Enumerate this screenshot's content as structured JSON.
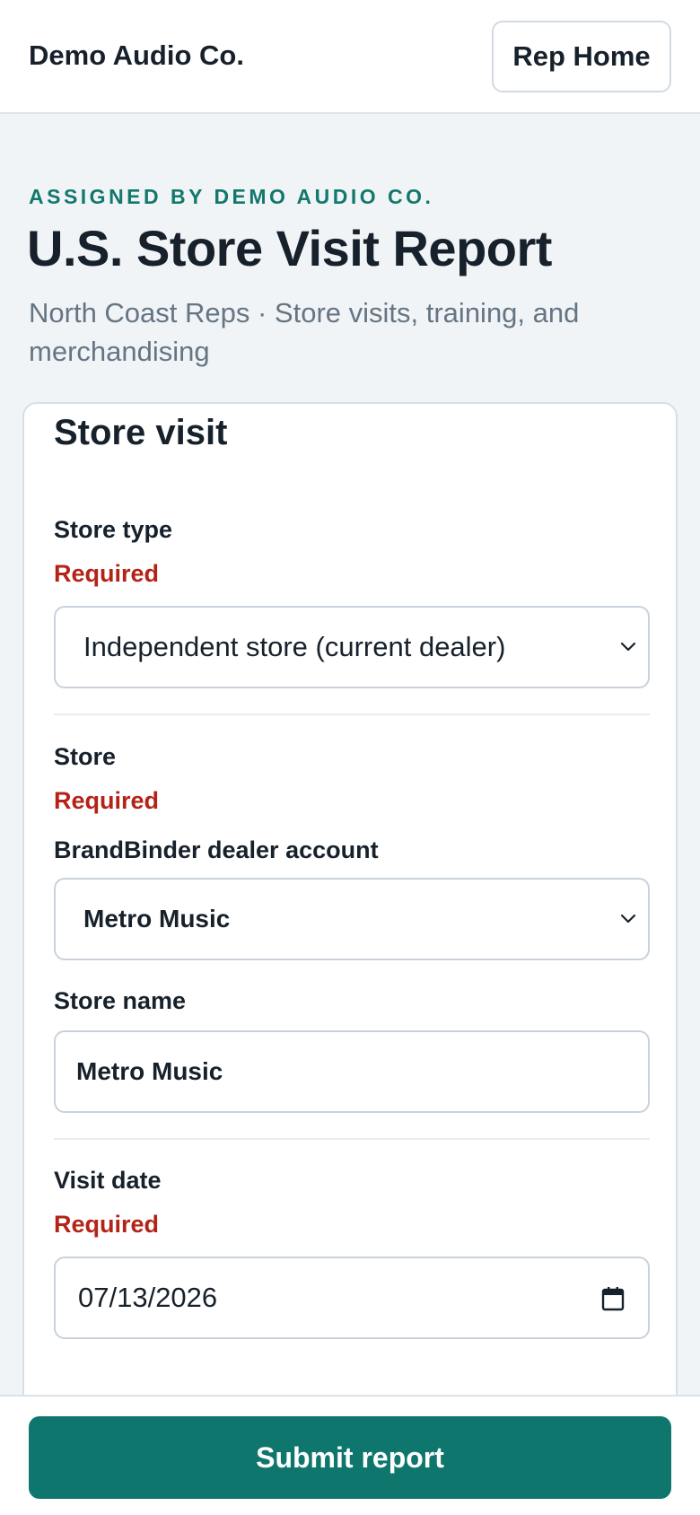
{
  "header": {
    "brand": "Demo Audio Co.",
    "rep_home_label": "Rep Home"
  },
  "page": {
    "eyebrow": "ASSIGNED BY DEMO AUDIO CO.",
    "title": "U.S. Store Visit Report",
    "subtitle": "North Coast Reps · Store visits, training, and merchandising"
  },
  "card": {
    "title": "Store visit",
    "store_type": {
      "label": "Store type",
      "required": "Required",
      "value": "Independent store (current dealer)"
    },
    "store": {
      "label": "Store",
      "required": "Required",
      "dealer_account_label": "BrandBinder dealer account",
      "dealer_account_value": "Metro Music",
      "store_name_label": "Store name",
      "store_name_value": "Metro Music"
    },
    "visit_date": {
      "label": "Visit date",
      "required": "Required",
      "value": "07/13/2026"
    }
  },
  "footer": {
    "submit_label": "Submit report"
  },
  "colors": {
    "accent": "#0f766e",
    "required": "#b42318",
    "eyebrow": "#12786c"
  },
  "icons": [
    "chevron-down-icon",
    "calendar-icon"
  ]
}
